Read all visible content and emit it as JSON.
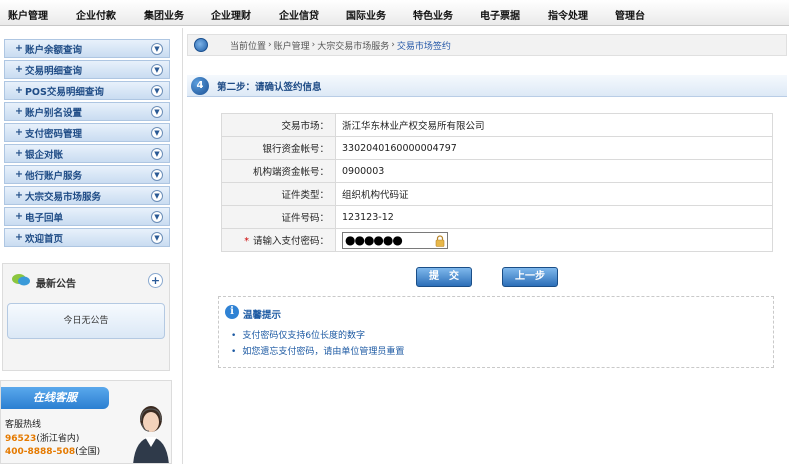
{
  "top_nav": {
    "items": [
      "账户管理",
      "企业付款",
      "集团业务",
      "企业理财",
      "企业信贷",
      "国际业务",
      "特色业务",
      "电子票据",
      "指令处理",
      "管理台"
    ]
  },
  "sidebar": {
    "items": [
      {
        "label": "账户余额查询"
      },
      {
        "label": "交易明细查询"
      },
      {
        "label": "POS交易明细查询"
      },
      {
        "label": "账户别名设置"
      },
      {
        "label": "支付密码管理"
      },
      {
        "label": "银企对账"
      },
      {
        "label": "他行账户服务"
      },
      {
        "label": "大宗交易市场服务"
      },
      {
        "label": "电子回单"
      },
      {
        "label": "欢迎首页"
      }
    ],
    "plus_symbol": "+",
    "notice": {
      "title": "最新公告",
      "expand_symbol": "+",
      "content": "今日无公告"
    },
    "service": {
      "banner": "在线客服",
      "hotline_label": "客服热线",
      "hotline_1_number": "96523",
      "hotline_1_note": "(浙江省内)",
      "hotline_2_number": "400-8888-508",
      "hotline_2_note": "(全国)"
    }
  },
  "breadcrumb": {
    "prefix": "当前位置",
    "items": [
      "账户管理",
      "大宗交易市场服务",
      "交易市场签约"
    ],
    "separator": "›"
  },
  "step": {
    "number": "4",
    "title": "第二步：请确认签约信息"
  },
  "form": {
    "rows": [
      {
        "label": "交易市场：",
        "value": "浙江华东林业产权交易所有限公司"
      },
      {
        "label": "银行资金帐号：",
        "value": "3302040160000004797"
      },
      {
        "label": "机构端资金帐号：",
        "value": "0900003"
      },
      {
        "label": "证件类型：",
        "value": "组织机构代码证"
      },
      {
        "label": "证件号码：",
        "value": "123123-12"
      }
    ],
    "password": {
      "required_mark": "*",
      "label": "请输入支付密码：",
      "masked_value": "●●●●●●"
    }
  },
  "buttons": {
    "submit": "提　交",
    "back": "上一步"
  },
  "tips": {
    "icon": "i",
    "title": "温馨提示",
    "items": [
      "支付密码仅支持6位长度的数字",
      "如您遗忘支付密码，请由单位管理员重置"
    ],
    "bullet": "•"
  },
  "colors": {
    "accent": "#1f4c86",
    "link": "#2558a8",
    "hotline": "#e57a00"
  }
}
